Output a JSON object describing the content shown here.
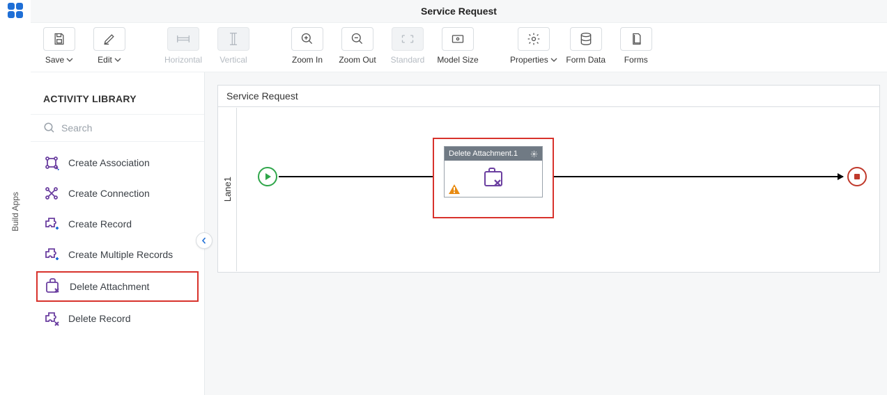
{
  "header": {
    "title": "Service Request"
  },
  "toolbar": {
    "save": "Save",
    "edit": "Edit",
    "horizontal": "Horizontal",
    "vertical": "Vertical",
    "zoom_in": "Zoom In",
    "zoom_out": "Zoom Out",
    "standard": "Standard",
    "model_size": "Model Size",
    "properties": "Properties",
    "form_data": "Form Data",
    "forms": "Forms"
  },
  "rail": {
    "build_apps": "Build Apps"
  },
  "sidebar": {
    "heading": "ACTIVITY LIBRARY",
    "search_placeholder": "Search",
    "items": [
      {
        "label": "Create Association",
        "icon": "assoc"
      },
      {
        "label": "Create Connection",
        "icon": "conn"
      },
      {
        "label": "Create Record",
        "icon": "puzzle-plus"
      },
      {
        "label": "Create Multiple Records",
        "icon": "puzzle-plus"
      },
      {
        "label": "Delete Attachment",
        "icon": "attach-x",
        "highlight": true
      },
      {
        "label": "Delete Record",
        "icon": "puzzle-x"
      }
    ]
  },
  "canvas": {
    "title": "Service Request",
    "lane": "Lane1",
    "activity": {
      "title": "Delete Attachment.1"
    }
  }
}
